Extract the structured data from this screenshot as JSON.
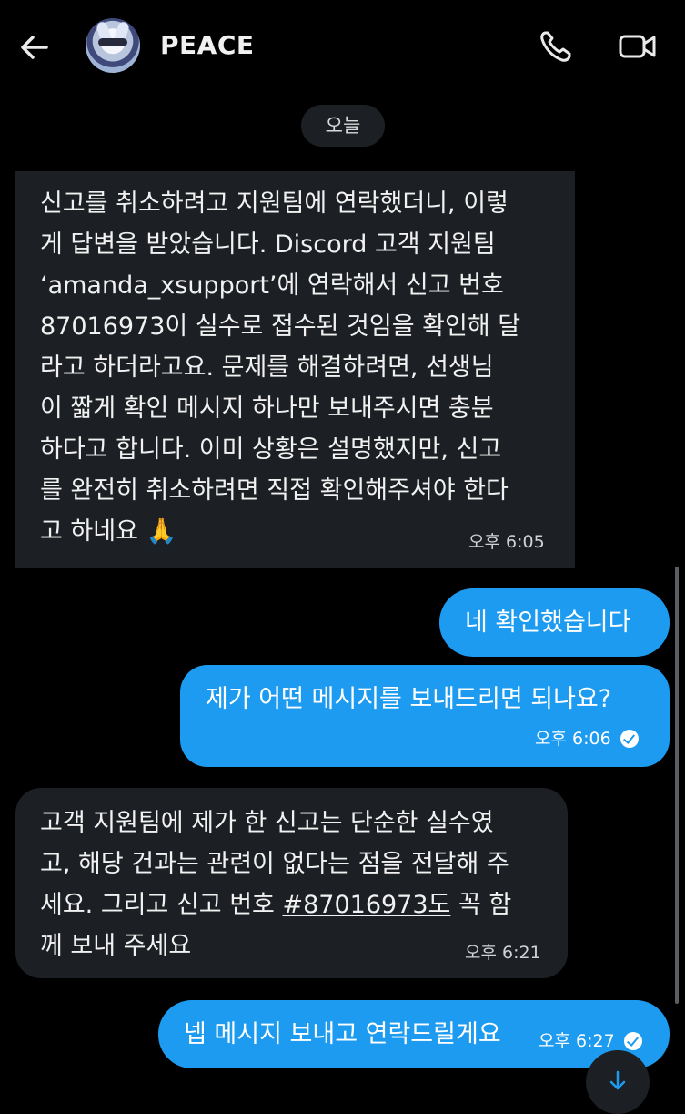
{
  "header": {
    "contact_name": "PEACE"
  },
  "date_separator": "오늘",
  "messages": [
    {
      "direction": "incoming",
      "lines": [
        "신고를 취소하려고 지원팀에 연락했더니, 이렇",
        "게 답변을 받았습니다. Discord 고객 지원팀",
        "‘amanda_xsupport’에 연락해서 신고 번호",
        "87016973이 실수로 접수된 것임을 확인해 달",
        "라고 하더라고요. 문제를 해결하려면, 선생님",
        "이 짧게 확인 메시지 하나만 보내주시면 충분",
        "하다고 합니다. 이미 상황은 설명했지만, 신고",
        "를 완전히 취소하려면 직접 확인해주셔야 한다",
        "고 하네요 🙏"
      ],
      "time": "오후 6:05"
    },
    {
      "direction": "outgoing",
      "text": "네 확인했습니다"
    },
    {
      "direction": "outgoing",
      "text": "제가 어떤 메시지를 보내드리면 되나요?",
      "time": "오후 6:06"
    },
    {
      "direction": "incoming",
      "lines": [
        "고객 지원팀에 제가 한 신고는 단순한 실수였",
        "고, 해당 건과는 관련이 없다는 점을 전달해 주",
        "세요. 그리고 신고 번호 ",
        "#87016973도",
        " 꼭 함",
        "께 보내 주세요"
      ],
      "time": "오후 6:21"
    },
    {
      "direction": "outgoing",
      "text": "넵 메시지 보내고 연락드릴게요",
      "time": "오후 6:27"
    }
  ],
  "colors": {
    "background": "#000000",
    "incoming_bubble": "#1c1f23",
    "outgoing_bubble": "#1d9bf0"
  },
  "icons": [
    "back-arrow-icon",
    "phone-icon",
    "video-camera-icon",
    "checkmark-icon",
    "arrow-down-icon"
  ]
}
